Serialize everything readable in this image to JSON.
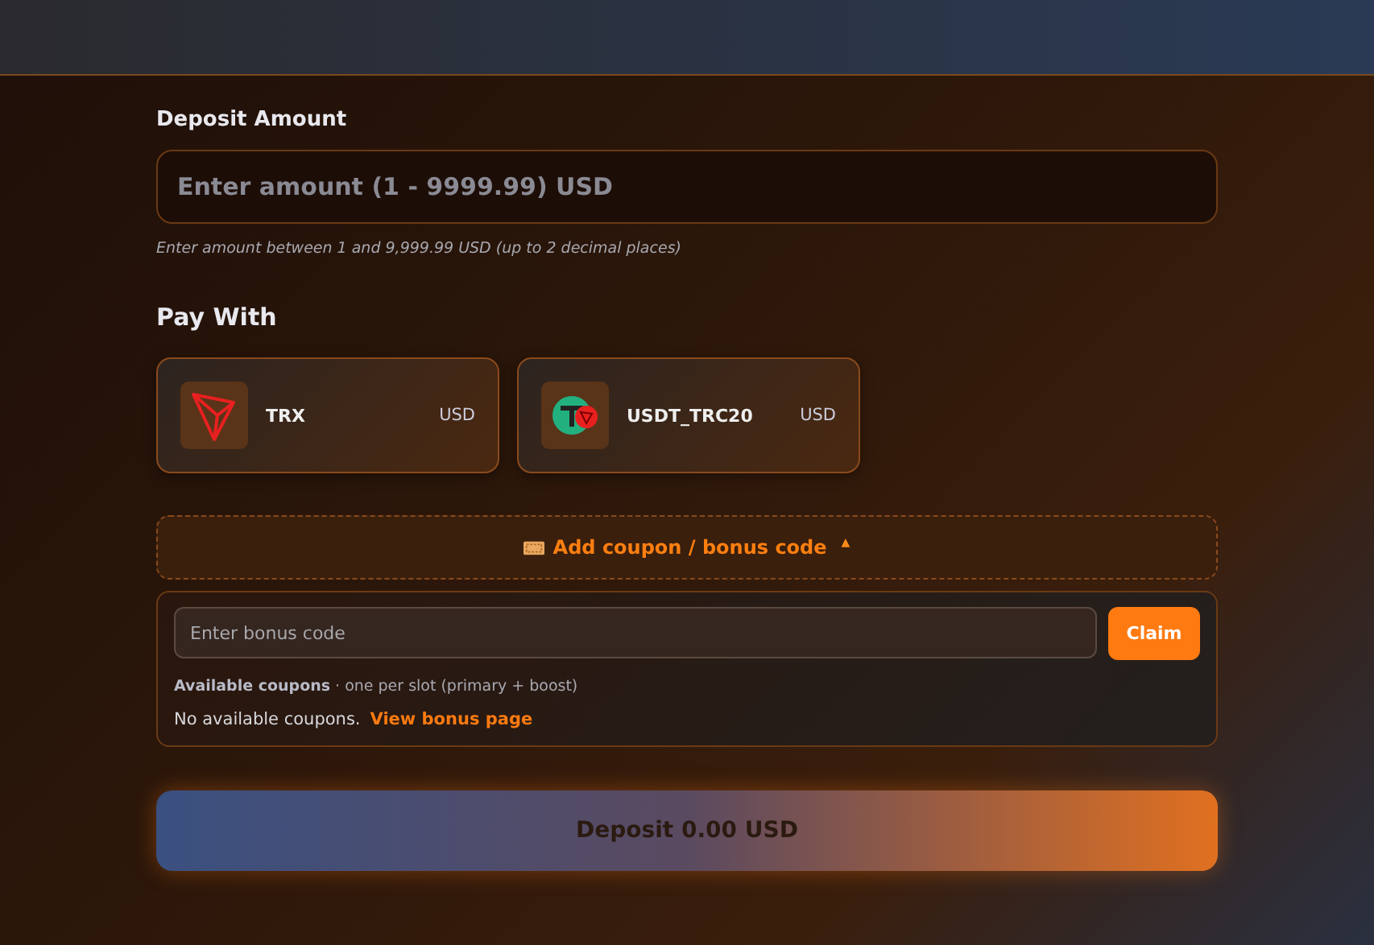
{
  "deposit": {
    "label": "Deposit Amount",
    "placeholder": "Enter amount (1 - 9999.99) USD",
    "hint": "Enter amount between 1 and 9,999.99 USD (up to 2 decimal places)"
  },
  "pay_with": {
    "title": "Pay With",
    "methods": [
      {
        "kind": "trx",
        "name": "TRX",
        "currency": "USD"
      },
      {
        "kind": "usdt",
        "name": "USDT_TRC20",
        "currency": "USD"
      }
    ]
  },
  "coupon": {
    "toggle": "Add coupon / bonus code",
    "arrow": "▲",
    "expanded": true,
    "placeholder": "Enter bonus code",
    "claim": "Claim",
    "available": "**Available coupons** · one per slot (primary + boost)",
    "empty": "No available coupons.",
    "link": "View bonus page"
  },
  "submit": "Deposit 0.00 USD"
}
